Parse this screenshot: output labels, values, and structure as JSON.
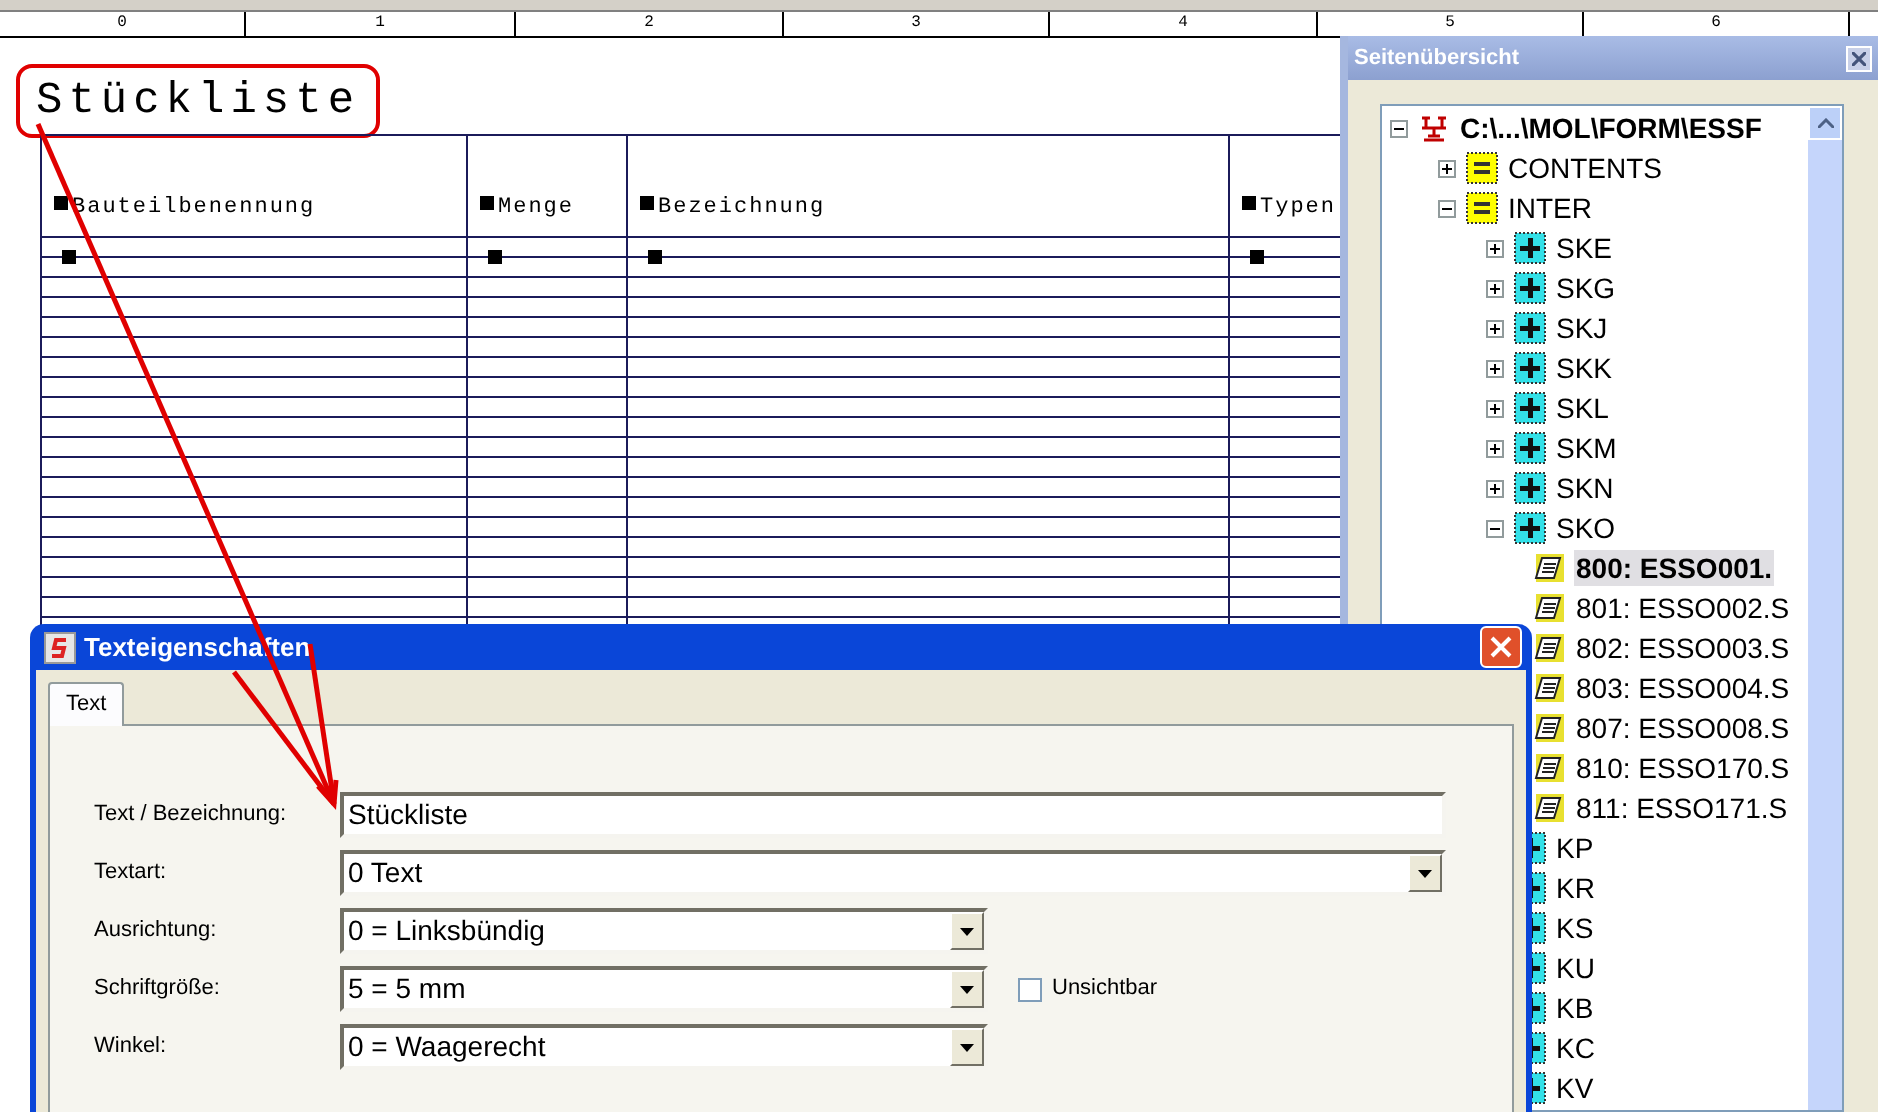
{
  "ruler": {
    "labels": [
      "0",
      "1",
      "2",
      "3",
      "4",
      "5",
      "6"
    ]
  },
  "form": {
    "title": "Stückliste",
    "columns": [
      "Bauteilbenennung",
      "Menge",
      "Bezeichnung",
      "Typen"
    ]
  },
  "page_overview": {
    "title": "Seitenübersicht",
    "tree": [
      {
        "kind": "root",
        "label": "C:\\...\\MOL\\FORM\\ESSF",
        "expanded": true,
        "selected": false,
        "children": [
          {
            "kind": "folder",
            "label": "CONTENTS",
            "expanded": false,
            "selected": false
          },
          {
            "kind": "folder",
            "label": "INTER",
            "expanded": true,
            "selected": false,
            "children": [
              {
                "kind": "group",
                "label": "SKE",
                "expanded": false,
                "selected": false
              },
              {
                "kind": "group",
                "label": "SKG",
                "expanded": false,
                "selected": false
              },
              {
                "kind": "group",
                "label": "SKJ",
                "expanded": false,
                "selected": false
              },
              {
                "kind": "group",
                "label": "SKK",
                "expanded": false,
                "selected": false
              },
              {
                "kind": "group",
                "label": "SKL",
                "expanded": false,
                "selected": false
              },
              {
                "kind": "group",
                "label": "SKM",
                "expanded": false,
                "selected": false
              },
              {
                "kind": "group",
                "label": "SKN",
                "expanded": false,
                "selected": false
              },
              {
                "kind": "group",
                "label": "SKO",
                "expanded": true,
                "selected": false,
                "children": [
                  {
                    "kind": "file",
                    "label": "800: ESSO001.",
                    "selected": true
                  },
                  {
                    "kind": "file",
                    "label": "801: ESSO002.S",
                    "selected": false
                  },
                  {
                    "kind": "file",
                    "label": "802: ESSO003.S",
                    "selected": false
                  },
                  {
                    "kind": "file",
                    "label": "803: ESSO004.S",
                    "selected": false
                  },
                  {
                    "kind": "file",
                    "label": "807: ESSO008.S",
                    "selected": false
                  },
                  {
                    "kind": "file",
                    "label": "810: ESSO170.S",
                    "selected": false
                  },
                  {
                    "kind": "file",
                    "label": "811: ESSO171.S",
                    "selected": false
                  }
                ]
              },
              {
                "kind": "group",
                "label": "KP",
                "selected": false
              },
              {
                "kind": "group",
                "label": "KR",
                "selected": false
              },
              {
                "kind": "group",
                "label": "KS",
                "selected": false
              },
              {
                "kind": "group",
                "label": "KU",
                "selected": false
              },
              {
                "kind": "group",
                "label": "KB",
                "selected": false
              },
              {
                "kind": "group",
                "label": "KC",
                "selected": false
              },
              {
                "kind": "group",
                "label": "KV",
                "selected": false
              }
            ]
          }
        ]
      }
    ]
  },
  "dialog": {
    "title": "Texteigenschaften",
    "tabs": [
      {
        "label": "Text",
        "selected": true
      }
    ],
    "fields": [
      {
        "kind": "text",
        "label": "Text / Bezeichnung:",
        "value": "Stückliste"
      },
      {
        "kind": "combo",
        "label": "Textart:",
        "value": "0 Text"
      },
      {
        "kind": "dropdown",
        "label": "Ausrichtung:",
        "value": "0 = Linksbündig"
      },
      {
        "kind": "dropdown",
        "label": "Schriftgröße:",
        "value": "5 = 5 mm",
        "checkbox": {
          "label": "Unsichtbar",
          "checked": false
        }
      },
      {
        "kind": "dropdown",
        "label": "Winkel:",
        "value": "0 = Waagerecht"
      }
    ]
  }
}
